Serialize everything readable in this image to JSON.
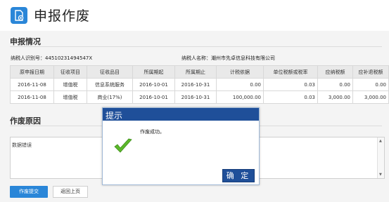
{
  "header": {
    "title": "申报作废",
    "icon": "document-cancel-icon"
  },
  "section1": {
    "title": "申报情况",
    "taxpayer_id": "纳税人识别号：44510231494547X",
    "taxpayer_name": "纳税人名称：潮州市先卓信息科技有限公司"
  },
  "table": {
    "headers": [
      "原申报日期",
      "征收项目",
      "征收品目",
      "所属期起",
      "所属期止",
      "计税依据",
      "单位税额或税率",
      "应纳税额",
      "应补退税额"
    ],
    "rows": [
      [
        "2016-11-08",
        "增值税",
        "信息系统服务",
        "2016-10-01",
        "2016-10-31",
        "0.00",
        "0.03",
        "0.00",
        "0.00"
      ],
      [
        "2016-11-08",
        "增值税",
        "商业(17%)",
        "2016-10-01",
        "2016-10-31",
        "100,000.00",
        "0.03",
        "3,000.00",
        "3,000.00"
      ]
    ]
  },
  "section2": {
    "title": "作废原因",
    "reason_value": "数据错误"
  },
  "buttons": {
    "submit": "作废提交",
    "back": "返回上页"
  },
  "modal": {
    "title": "提示",
    "message": "作废成功。",
    "ok": "确 定",
    "icon": "success-check-icon"
  },
  "colors": {
    "primary": "#2a86d8",
    "modal_title": "#1f4f99",
    "check": "#5cb82a"
  }
}
